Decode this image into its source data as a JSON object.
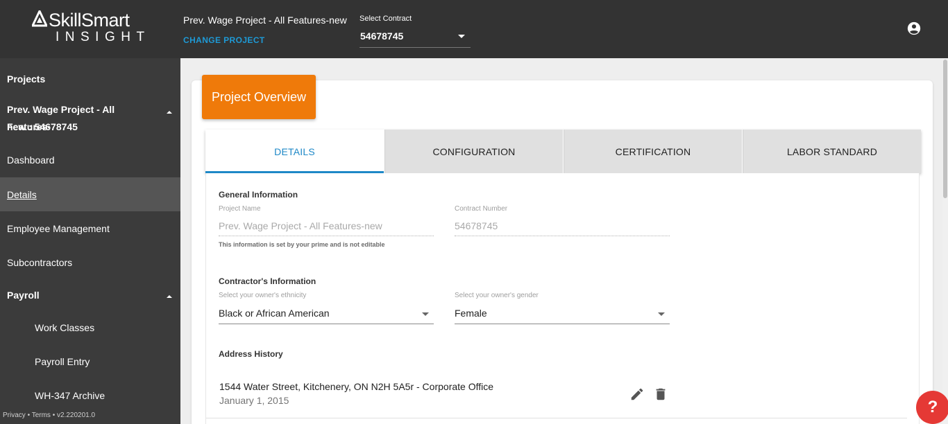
{
  "brand": {
    "top": "SkillSmart",
    "bottom": "INSIGHT"
  },
  "header": {
    "project_title": "Prev. Wage Project - All Features-new",
    "change_project": "CHANGE PROJECT",
    "contract_label": "Select Contract",
    "contract_value": "54678745",
    "account_icon": "account-circle-icon"
  },
  "sidebar": {
    "projects": "Projects",
    "project_line1": "Prev. Wage Project - All Features-",
    "project_line2": "new : 54678745",
    "dashboard": "Dashboard",
    "details": "Details",
    "employee_management": "Employee Management",
    "subcontractors": "Subcontractors",
    "payroll": "Payroll",
    "work_classes": "Work Classes",
    "payroll_entry": "Payroll Entry",
    "wh347_archive": "WH-347 Archive",
    "footer": {
      "privacy": "Privacy",
      "sep1": " • ",
      "terms": "Terms",
      "sep2": " • ",
      "version": "v2.220201.0"
    }
  },
  "overview": {
    "title": "Project Overview"
  },
  "tabs": [
    {
      "label": "DETAILS"
    },
    {
      "label": "CONFIGURATION"
    },
    {
      "label": "CERTIFICATION"
    },
    {
      "label": "LABOR STANDARD"
    }
  ],
  "general": {
    "title": "General Information",
    "project_name_label": "Project Name",
    "project_name_value": "Prev. Wage Project - All Features-new",
    "contract_number_label": "Contract Number",
    "contract_number_value": "54678745",
    "hint": "This information is set by your prime and is not editable"
  },
  "contractor": {
    "title": "Contractor's Information",
    "ethnicity_label": "Select your owner's ethnicity",
    "ethnicity_value": "Black or African American",
    "gender_label": "Select your owner's gender",
    "gender_value": "Female"
  },
  "address": {
    "title": "Address History",
    "line1": "1544 Water Street, Kitchenery, ON N2H 5A5r - Corporate Office",
    "line2": "January 1, 2015"
  },
  "help": {
    "label": "?"
  },
  "colors": {
    "accent_orange": "#ef7a0a",
    "link_blue": "#1e88c7",
    "header_bg": "#333333",
    "sidebar_bg": "#3b3b3b",
    "help_red": "#e53935"
  }
}
